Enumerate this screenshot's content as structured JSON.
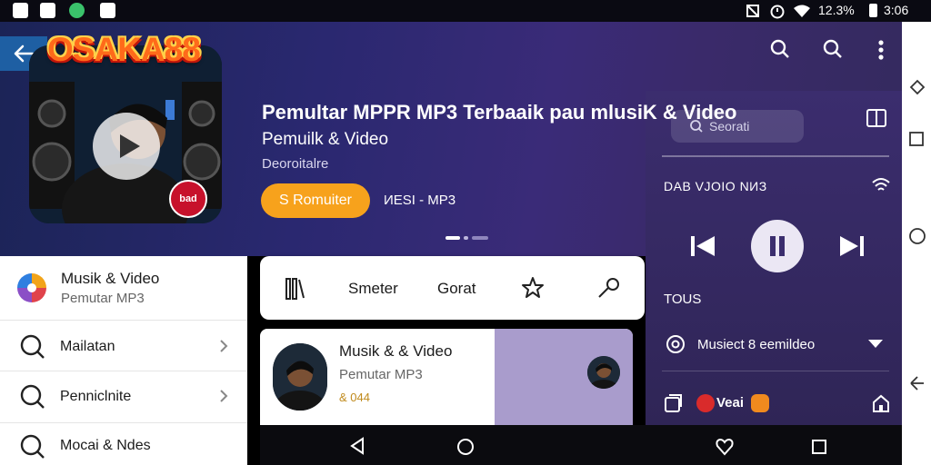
{
  "status_bar": {
    "battery": "12.3%",
    "time": "3:06"
  },
  "app": {
    "logo": "OSAKA88",
    "title": "Pemultar MPPR MP3 Terbaaik  pau mlusiK & Video",
    "subtitle": "Pemuilk & Video",
    "developer": "Deoroitalre",
    "install_label": "S Romuiter",
    "tagline": "ИESI - MP3",
    "badge": "bad"
  },
  "header": {
    "search_placeholder": "Seorati"
  },
  "player": {
    "now_playing": "DAB VJOIO NИЗ",
    "tools_label": "TOUS",
    "radio_label": "Musiect 8 eemildeo",
    "reward_label": "Veai"
  },
  "drawer": {
    "title": "Musik & Video",
    "subtitle": "Pemutar MP3",
    "items": [
      {
        "label": "Mailatan"
      },
      {
        "label": "Penniclnite"
      },
      {
        "label": "Mocai & Ndes"
      }
    ]
  },
  "tabs": {
    "tab1": "Smeter",
    "tab2": "Gorat"
  },
  "card": {
    "title": "Musik & & Video",
    "subtitle": "Pemutar MP3",
    "rating": "& 044"
  },
  "colors": {
    "accent": "#f7a21c",
    "hero_bg": "#2a2870",
    "panel_bg": "#3b2d6e",
    "back_tab": "#1e5fa3"
  },
  "icons": [
    "back-arrow-icon",
    "search-icon",
    "more-vert-icon",
    "play-icon",
    "pause-icon",
    "skip-prev-icon",
    "skip-next-icon",
    "wifi-icon",
    "split-view-icon",
    "library-icon",
    "star-icon",
    "key-icon",
    "chevron-right-icon",
    "dropdown-icon",
    "radio-icon",
    "gift-icon",
    "home-icon",
    "triangle-back-icon",
    "square-icon",
    "circle-icon"
  ]
}
